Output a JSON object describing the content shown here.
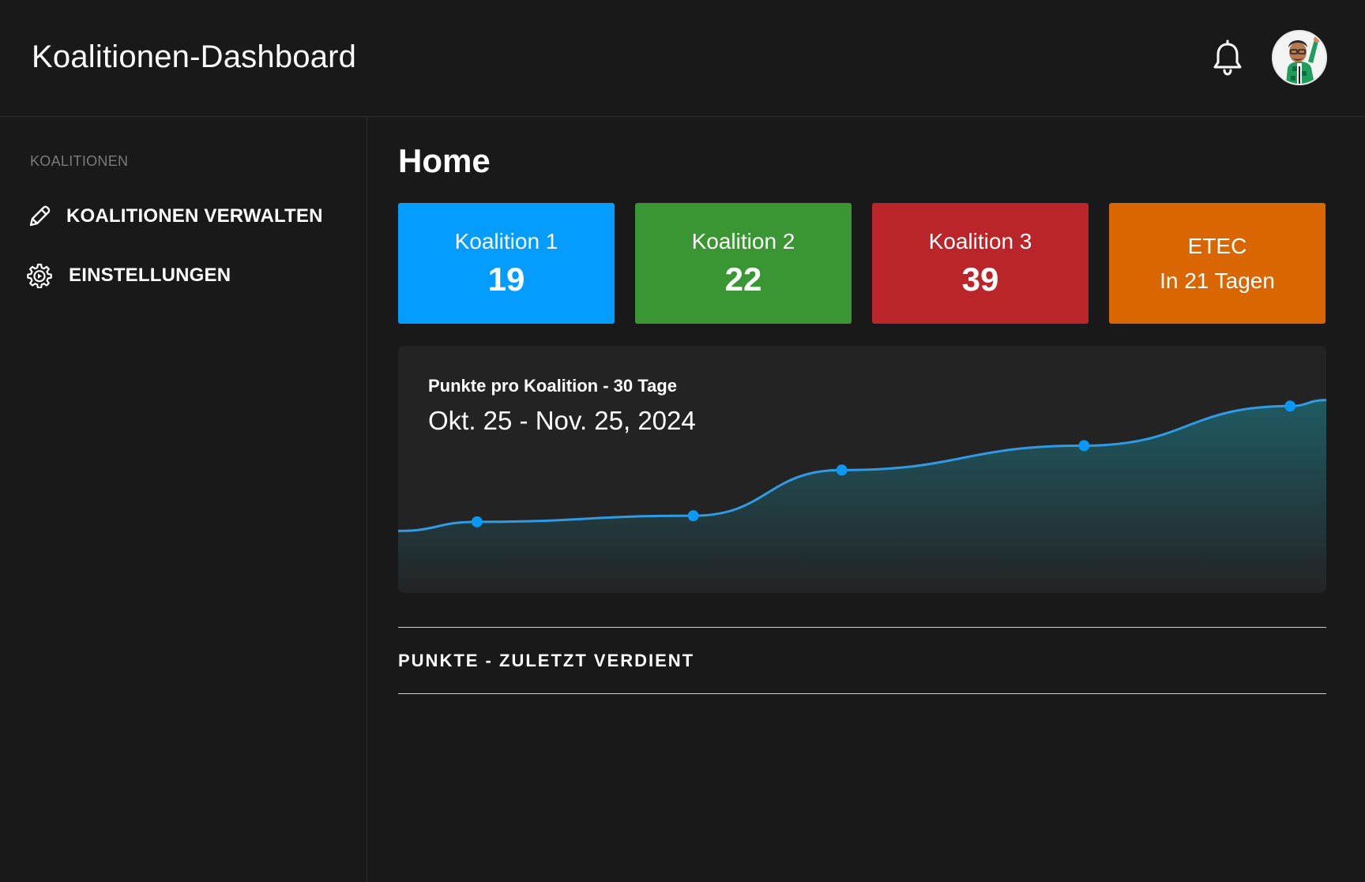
{
  "header": {
    "title": "Koalitionen-Dashboard",
    "notification_icon": "bell-icon",
    "avatar_icon": "user-avatar-icon"
  },
  "sidebar": {
    "section_heading": "KOALITIONEN",
    "items": [
      {
        "label": "KOALITIONEN VERWALTEN",
        "icon": "pencil-icon"
      },
      {
        "label": "EINSTELLUNGEN",
        "icon": "gear-icon"
      }
    ]
  },
  "main": {
    "title": "Home",
    "cards": [
      {
        "label": "Koalition 1",
        "value": "19",
        "color": "#049cff"
      },
      {
        "label": "Koalition 2",
        "value": "22",
        "color": "#3a9632"
      },
      {
        "label": "Koalition 3",
        "value": "39",
        "color": "#b92528"
      },
      {
        "label": "ETEC",
        "value": "In 21 Tagen",
        "color": "#d96600"
      }
    ],
    "chart": {
      "title": "Punkte pro Koalition - 30 Tage",
      "range": "Okt. 25 - Nov. 25, 2024"
    },
    "recent_section_title": "PUNKTE - ZULETZT VERDIENT"
  },
  "colors": {
    "background": "#191919",
    "panel": "#232323",
    "line": "#2f9be5",
    "point": "#0b97f5",
    "area_top": "#1f5d66"
  },
  "chart_data": {
    "type": "area",
    "title": "Punkte pro Koalition - 30 Tage",
    "subtitle": "Okt. 25 - Nov. 25, 2024",
    "xlabel": "",
    "ylabel": "",
    "x": [
      0.085,
      0.318,
      0.478,
      0.739,
      0.961
    ],
    "values": [
      20,
      22,
      37,
      45,
      58
    ],
    "series_start": 17,
    "series_end": 60,
    "ylim": [
      0,
      70
    ],
    "grid": false,
    "legend": "none"
  }
}
